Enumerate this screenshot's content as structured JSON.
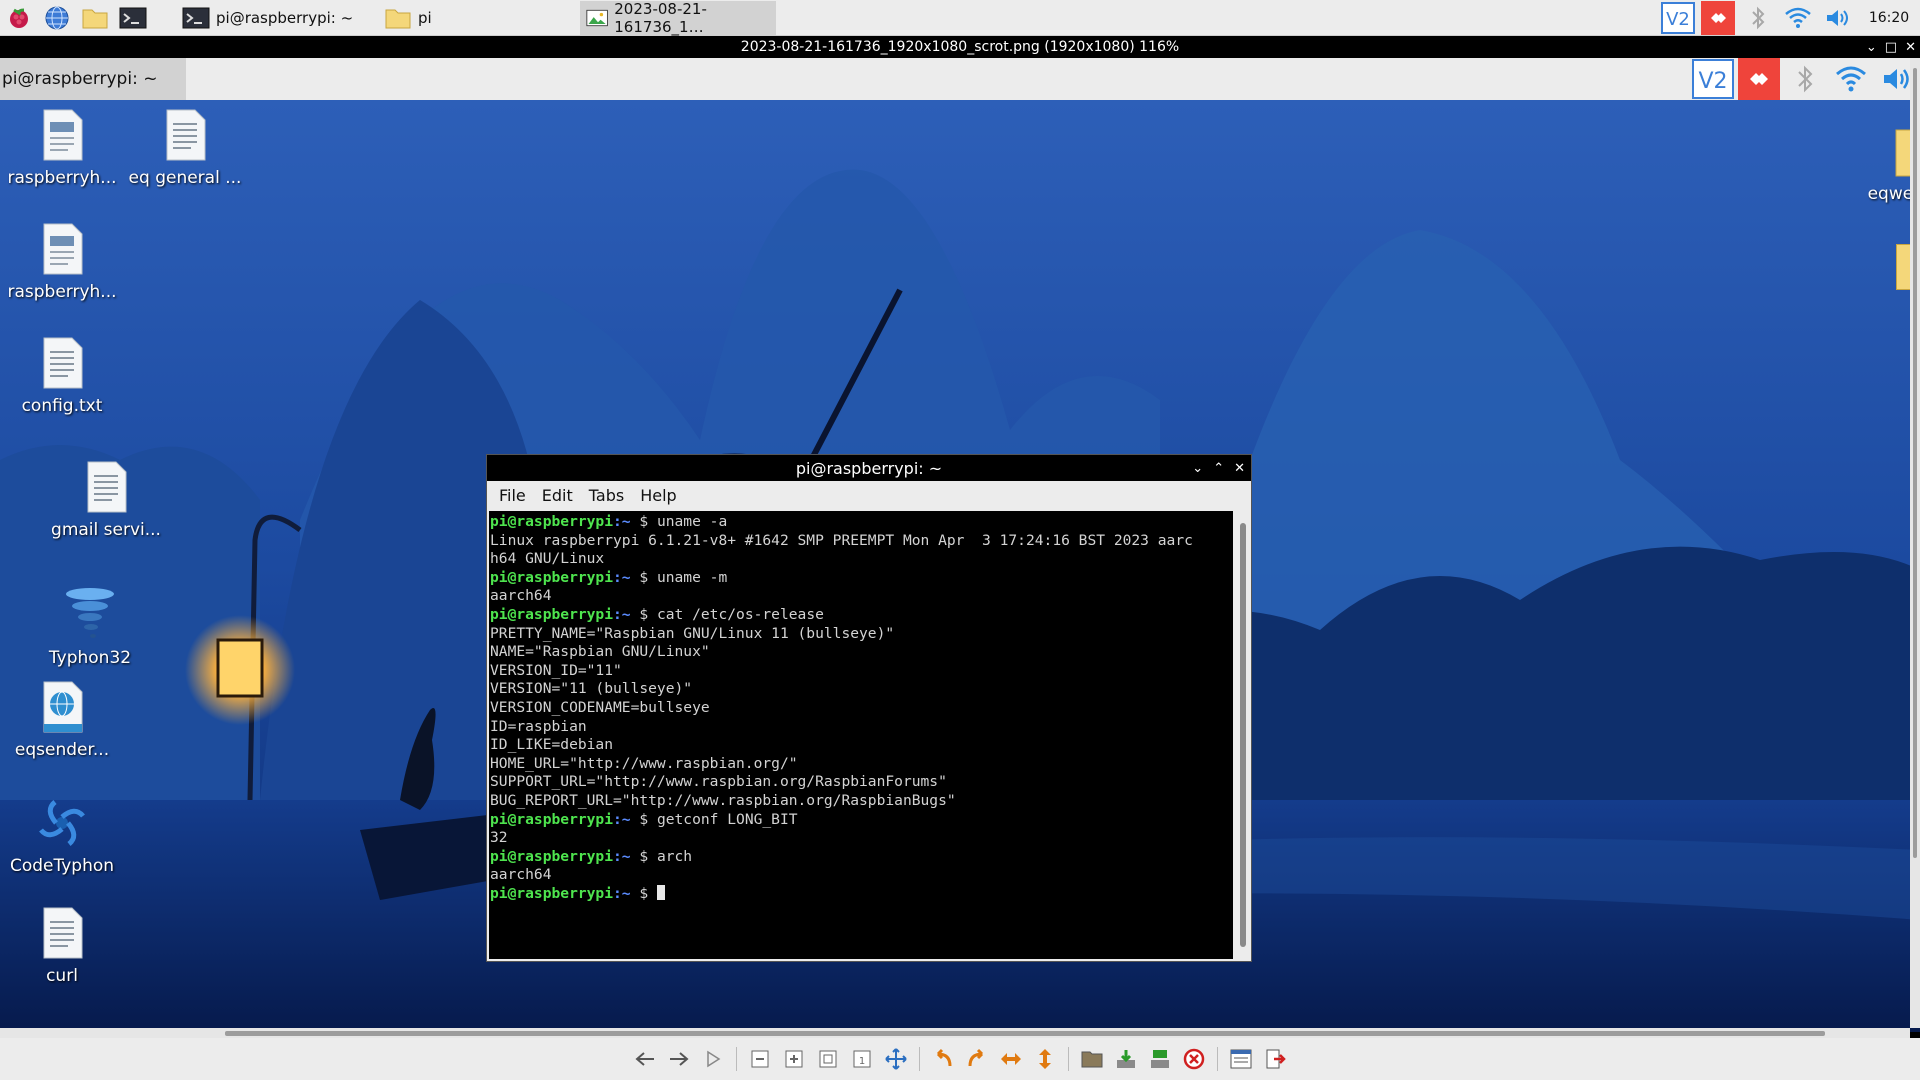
{
  "taskbar": {
    "launchers": [
      "raspberry-menu-icon",
      "browser-icon",
      "file-manager-icon",
      "terminal-icon"
    ],
    "tasks": [
      {
        "label": "pi@raspberrypi: ~",
        "icon": "terminal-icon"
      },
      {
        "label": "pi",
        "icon": "folder-icon"
      },
      {
        "label": "2023-08-21-161736_1…",
        "icon": "image-icon"
      }
    ],
    "tray": [
      "vnc-icon",
      "anydesk-icon",
      "bluetooth-icon",
      "wifi-icon",
      "volume-icon"
    ],
    "clock": "16:20"
  },
  "viewer": {
    "title": "2023-08-21-161736_1920x1080_scrot.png (1920x1080) 116%",
    "toolbar": [
      "prev-icon",
      "next-icon",
      "play-icon",
      "zoom-out-icon",
      "zoom-in-icon",
      "fit-icon",
      "original-size-icon",
      "fullscreen-icon",
      "rotate-left-icon",
      "rotate-right-icon",
      "flip-horizontal-icon",
      "flip-vertical-icon",
      "open-icon",
      "save-icon",
      "save-as-icon",
      "delete-icon",
      "preferences-icon",
      "exit-icon"
    ]
  },
  "inner": {
    "task_label": "pi@raspberrypi: ~",
    "desktop_icons": [
      {
        "label": "raspberryh...",
        "icon": "document-icon"
      },
      {
        "label": "eq general ...",
        "icon": "text-file-icon"
      },
      {
        "label": "raspberryh...",
        "icon": "document-icon"
      },
      {
        "label": "config.txt",
        "icon": "text-file-icon"
      },
      {
        "label": "gmail servi...",
        "icon": "text-file-icon"
      },
      {
        "label": "Typhon32",
        "icon": "tornado-icon"
      },
      {
        "label": "eqsender...",
        "icon": "globe-file-icon"
      },
      {
        "label": "CodeTyphon",
        "icon": "swirl-icon"
      },
      {
        "label": "curl",
        "icon": "text-file-icon"
      },
      {
        "label": "eqweb",
        "icon": "folder-icon"
      }
    ],
    "terminal": {
      "title": "pi@raspberrypi: ~",
      "menu": [
        "File",
        "Edit",
        "Tabs",
        "Help"
      ],
      "prompt_user": "pi@raspberrypi",
      "prompt_path": ":~",
      "prompt_dollar": " $ ",
      "lines": [
        {
          "type": "cmd",
          "text": "uname -a"
        },
        {
          "type": "out",
          "text": "Linux raspberrypi 6.1.21-v8+ #1642 SMP PREEMPT Mon Apr  3 17:24:16 BST 2023 aarc"
        },
        {
          "type": "out",
          "text": "h64 GNU/Linux"
        },
        {
          "type": "cmd",
          "text": "uname -m"
        },
        {
          "type": "out",
          "text": "aarch64"
        },
        {
          "type": "cmd",
          "text": "cat /etc/os-release"
        },
        {
          "type": "out",
          "text": "PRETTY_NAME=\"Raspbian GNU/Linux 11 (bullseye)\""
        },
        {
          "type": "out",
          "text": "NAME=\"Raspbian GNU/Linux\""
        },
        {
          "type": "out",
          "text": "VERSION_ID=\"11\""
        },
        {
          "type": "out",
          "text": "VERSION=\"11 (bullseye)\""
        },
        {
          "type": "out",
          "text": "VERSION_CODENAME=bullseye"
        },
        {
          "type": "out",
          "text": "ID=raspbian"
        },
        {
          "type": "out",
          "text": "ID_LIKE=debian"
        },
        {
          "type": "out",
          "text": "HOME_URL=\"http://www.raspbian.org/\""
        },
        {
          "type": "out",
          "text": "SUPPORT_URL=\"http://www.raspbian.org/RaspbianForums\""
        },
        {
          "type": "out",
          "text": "BUG_REPORT_URL=\"http://www.raspbian.org/RaspbianBugs\""
        },
        {
          "type": "cmd",
          "text": "getconf LONG_BIT"
        },
        {
          "type": "out",
          "text": "32"
        },
        {
          "type": "cmd",
          "text": "arch"
        },
        {
          "type": "out",
          "text": "aarch64"
        },
        {
          "type": "cmd",
          "text": ""
        }
      ]
    }
  },
  "colors": {
    "prompt_user": "#4ee44e",
    "prompt_path": "#5b8cff",
    "anydesk": "#ef443b",
    "vnc": "#3b7fd8",
    "wallpaper_sky": "#1e4fa6",
    "wallpaper_water": "#082060"
  }
}
